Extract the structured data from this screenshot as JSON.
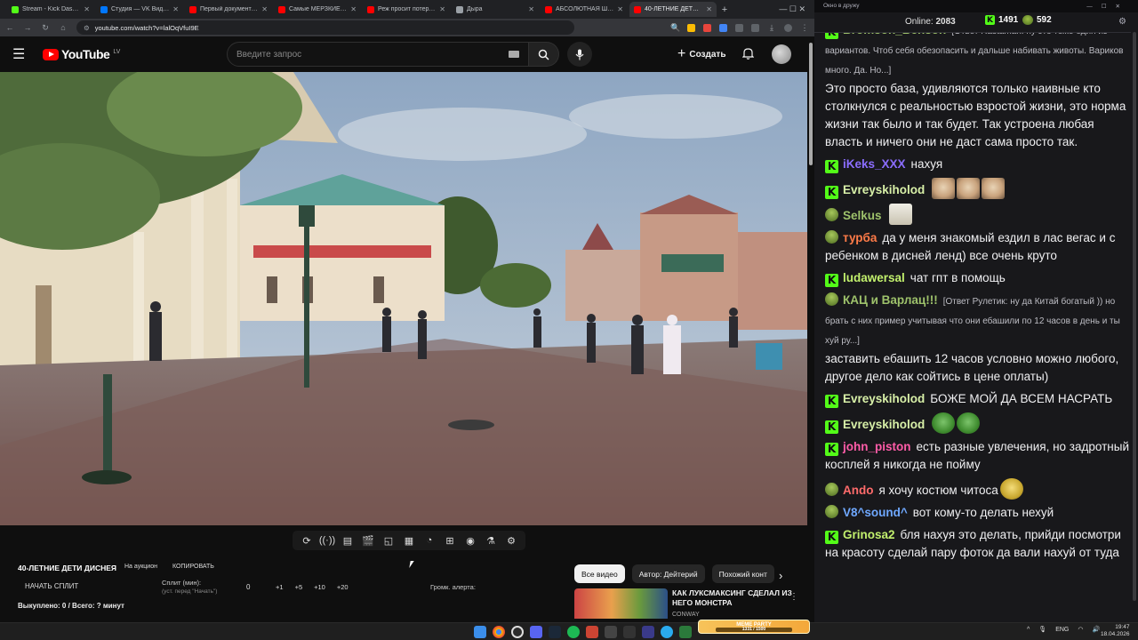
{
  "browser": {
    "tabs": [
      {
        "label": "Stream - Kick Dashboard",
        "color": "#53fc18",
        "active": false
      },
      {
        "label": "Студия — VK Видео Live",
        "color": "#0077ff",
        "active": false
      },
      {
        "label": "Первый документальный",
        "color": "#ff0000",
        "active": false
      },
      {
        "label": "Самые МЕРЗКИЕ форум",
        "color": "#ff0000",
        "active": false
      },
      {
        "label": "Реж просит потерпеть",
        "color": "#ff0000",
        "active": false
      },
      {
        "label": "Дыра",
        "color": "#9aa0a6",
        "active": false
      },
      {
        "label": "АБСОЛЮТНАЯ ШИЗОФ",
        "color": "#ff0000",
        "active": false
      },
      {
        "label": "40-ЛЕТНИЕ ДЕТИ ДИСНЕЯ",
        "color": "#ff0000",
        "active": true
      }
    ],
    "url": "youtube.com/watch?v=lalOqVfuI9E",
    "window_controls": "— ☐ ✕"
  },
  "youtube": {
    "logo_text": "YouTube",
    "country_code": "LV",
    "search_placeholder": "Введите запрос",
    "create_label": "Создать"
  },
  "player_toolbar": {
    "icons": [
      "loop-icon",
      "audio-wave-icon",
      "stream-icon",
      "clapper-icon",
      "picture-in-picture-icon",
      "film-icon",
      "speed-icon",
      "add-frame-icon",
      "screenshot-icon",
      "beaker-icon",
      "gear-icon"
    ]
  },
  "below_video": {
    "title": "40-ЛЕТНИЕ ДЕТИ ДИСНЕЯ",
    "auction_label": "На аукцион",
    "copy_label": "КОПИРОВАТЬ",
    "start_split_label": "НАЧАТЬ СПЛИТ",
    "split_min_label": "Сплит (мин):",
    "split_hint": "(уст. перед \"Начать\")",
    "split_value": "0",
    "increments": [
      "+1",
      "+5",
      "+10",
      "+20"
    ],
    "alert_volume_label": "Громк. алерта:",
    "bought_label": "Выкуплено: 0 / Всего: ? минут"
  },
  "filter_chips": [
    {
      "label": "Все видео",
      "active": true
    },
    {
      "label": "Автор: Дейтерий",
      "active": false
    },
    {
      "label": "Похожий конт",
      "active": false
    }
  ],
  "recommended": {
    "title": "КАК ЛУКСМАКСИНГ СДЕЛАЛ ИЗ НЕГО МОНСТРА",
    "channel": "CONWAY"
  },
  "chat": {
    "window_title": "Окно в дружу",
    "online_label": "Online:",
    "online_count": "2083",
    "kick_count": "1491",
    "gold_count": "592",
    "messages": [
      {
        "badge": "k",
        "user": "Bromson_Benson",
        "user_color": "#9ec26b",
        "reply": "[Ответ Rastaman: ну это тоже один из вариантов. Чтоб себя обезопасить и дальше набивать животы. Вариков много. Да. Но...]",
        "text": "Это просто база, удивляются только наивные кто столкнулся с реальностью взростой жизни, это норма жизни так было и так будет. Так устроена любая власть и ничего они не даст сама просто так."
      },
      {
        "badge": "k",
        "user": "iKeks_XXX",
        "user_color": "#8b6dff",
        "reply": "",
        "text": "нахуя"
      },
      {
        "badge": "k",
        "user": "Evreyskiholod",
        "user_color": "#d8f0a8",
        "reply": "",
        "text": "",
        "emotes": [
          "cat",
          "cat",
          "cat"
        ]
      },
      {
        "badge": "g",
        "user": "Selkus",
        "user_color": "#9ec26b",
        "reply": "",
        "text": "",
        "emotes": [
          "dog"
        ]
      },
      {
        "badge": "g",
        "user": "турба",
        "user_color": "#ff7b48",
        "reply": "",
        "text": "да у меня знакомый ездил в лас вегас и с ребенком в дисней ленд) все очень круто"
      },
      {
        "badge": "k",
        "user": "ludawersal",
        "user_color": "#c2f06d",
        "reply": "",
        "text": "чат гпт в помощь"
      },
      {
        "badge": "g",
        "user": "КАЦ и Варлац!!!",
        "user_color": "#9ec26b",
        "reply": "[Ответ Рулетик: ну да Китай богатый )) но брать с них пример учитывая что они ебашили по 12 часов в день и ты хуй ру...]",
        "text": "заставить ебашить 12 часов условно можно любого, другое дело как сойтись в цене оплаты)"
      },
      {
        "badge": "k",
        "user": "Evreyskiholod",
        "user_color": "#d8f0a8",
        "reply": "",
        "text": "БОЖЕ МОЙ ДА ВСЕМ НАСРАТЬ"
      },
      {
        "badge": "k",
        "user": "Evreyskiholod",
        "user_color": "#d8f0a8",
        "reply": "",
        "text": "",
        "emotes": [
          "pepe",
          "pepe"
        ]
      },
      {
        "badge": "k",
        "user": "john_piston",
        "user_color": "#ff5ca8",
        "reply": "",
        "text": "есть разные увлечения, но задротный косплей я никогда не пойму"
      },
      {
        "badge": "g",
        "user": "Ando",
        "user_color": "#ff6b6b",
        "reply": "",
        "text": "я хочу костюм читоса",
        "emotes": [
          "face"
        ]
      },
      {
        "badge": "g",
        "user": "V8^sound^",
        "user_color": "#6fa8ff",
        "reply": "",
        "text": "вот кому-то делать нехуй"
      },
      {
        "badge": "k",
        "user": "Grinosa2",
        "user_color": "#c2f06d",
        "reply": "",
        "text": "бля нахуя это делать, прийди посмотри на красоту сделай пару фоток да вали нахуй от туда"
      }
    ]
  },
  "taskbar": {
    "meme_title": "MEME PARTY",
    "meme_progress": "1331 / 1500",
    "lang": "ENG",
    "time": "19:47",
    "date": "18.04.2026"
  }
}
